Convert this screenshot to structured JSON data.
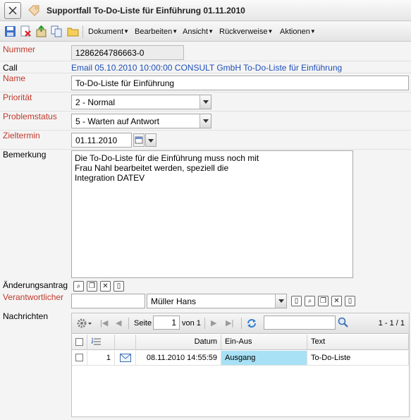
{
  "window": {
    "title": "Supportfall To-Do-Liste für Einführung 01.11.2010"
  },
  "toolbar": {
    "menus": [
      "Dokument",
      "Bearbeiten",
      "Ansicht",
      "Rückverweise",
      "Aktionen"
    ]
  },
  "form": {
    "nummer_label": "Nummer",
    "nummer_value": "1286264786663-0",
    "call_label": "Call",
    "call_value": "Email 05.10.2010 10:00:00 CONSULT GmbH To-Do-Liste für Einführung",
    "name_label": "Name",
    "name_value": "To-Do-Liste für Einführung",
    "prioritaet_label": "Priorität",
    "prioritaet_value": "2 - Normal",
    "problemstatus_label": "Problemstatus",
    "problemstatus_value": "5 - Warten auf Antwort",
    "zieltermin_label": "Zieltermin",
    "zieltermin_value": "01.11.2010",
    "bemerkung_label": "Bemerkung",
    "bemerkung_lines": [
      "Die To-Do-Liste für die Einführung muss noch mit",
      "Frau Nahl bearbeitet werden, speziell die",
      "Integration DATEV"
    ],
    "aenderungsantrag_label": "Änderungsantrag",
    "verantwortlicher_label": "Verantwortlicher",
    "verantwortlicher_value": "Müller Hans",
    "nachrichten_label": "Nachrichten"
  },
  "grid": {
    "page_label": "Seite",
    "page_value": "1",
    "of_label": "von 1",
    "range": "1 - 1 / 1",
    "columns": [
      "Datum",
      "Ein-Aus",
      "Text"
    ],
    "rows": [
      {
        "num": "1",
        "datum": "08.11.2010 14:55:59",
        "einaus": "Ausgang",
        "text": "To-Do-Liste"
      }
    ],
    "highlight_color": "#a8e1f5"
  }
}
